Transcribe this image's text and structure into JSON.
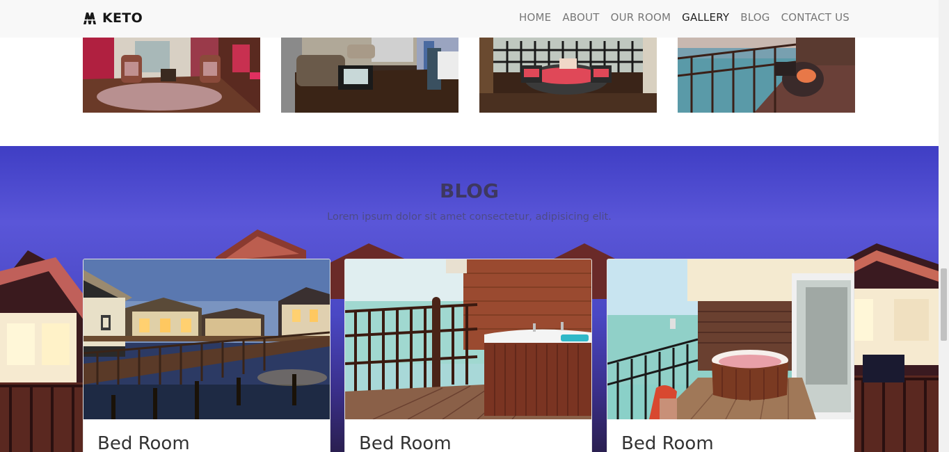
{
  "navbar": {
    "brand": "KETO",
    "links": [
      "HOME",
      "ABOUT",
      "OUR ROOM",
      "GALLERY",
      "BLOG",
      "CONTACT US"
    ],
    "active": "GALLERY"
  },
  "blog": {
    "title": "BLOG",
    "subtitle": "Lorem ipsum dolor sit amet consectetur, adipisicing elit.",
    "cards": [
      {
        "title": "Bed Room"
      },
      {
        "title": "Bed Room"
      },
      {
        "title": "Bed Room"
      }
    ]
  },
  "colors": {
    "navbar_bg": "#f8f8f8",
    "blog_bg": "#4a48c4",
    "title": "#3e3860"
  }
}
